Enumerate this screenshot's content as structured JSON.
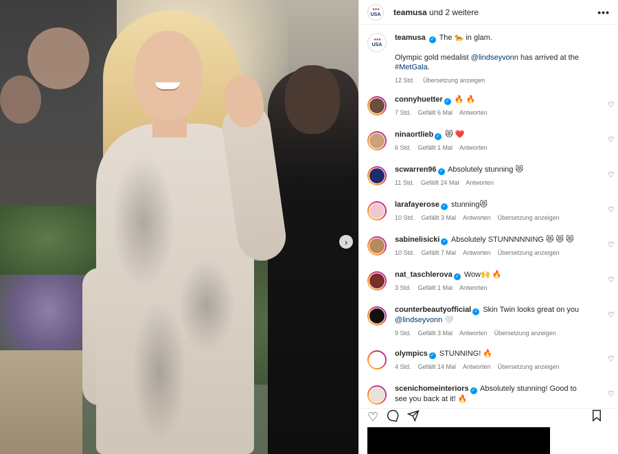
{
  "header": {
    "account": "teamusa",
    "suffix": "und 2 weitere",
    "more_icon": "more-horizontal-icon"
  },
  "logo_text": "USA",
  "caption": {
    "username": "teamusa",
    "line1_a": "The",
    "line1_emoji": "🐆",
    "line1_b": "in glam.",
    "line2_a": "Olympic gold medalist",
    "mention": "@lindseyvonn",
    "line2_b": "has arrived at the",
    "hashtag": "#MetGala",
    "line2_end": ".",
    "time": "12 Std.",
    "translate": "Übersetzung anzeigen"
  },
  "comments": [
    {
      "username": "connyhuetter",
      "text": "🔥 🔥",
      "time": "7 Std.",
      "likes": "Gefällt 6 Mal",
      "reply": "Antworten",
      "translate": "",
      "avatar_color": "#6b4e3d"
    },
    {
      "username": "ninaortlieb",
      "text": "😻 ❤️",
      "time": "6 Std.",
      "likes": "Gefällt 1 Mal",
      "reply": "Antworten",
      "translate": "",
      "avatar_color": "#c9a27a"
    },
    {
      "username": "scwarren96",
      "text": "Absolutely stunning 😻",
      "time": "11 Std.",
      "likes": "Gefällt 24 Mal",
      "reply": "Antworten",
      "translate": "",
      "avatar_color": "#1e2a6b"
    },
    {
      "username": "larafayerose",
      "text": "stunning😻",
      "time": "10 Std.",
      "likes": "Gefällt 3 Mal",
      "reply": "Antworten",
      "translate": "Übersetzung anzeigen",
      "avatar_color": "#f2c7cf"
    },
    {
      "username": "sabinelisicki",
      "text": "Absolutely STUNNNNNING 😻 😻 😻",
      "time": "10 Std.",
      "likes": "Gefällt 7 Mal",
      "reply": "Antworten",
      "translate": "Übersetzung anzeigen",
      "avatar_color": "#b88a5a"
    },
    {
      "username": "nat_taschlerova",
      "text": "Wow🙌 🔥",
      "time": "3 Std.",
      "likes": "Gefällt 1 Mal",
      "reply": "Antworten",
      "translate": "",
      "avatar_color": "#7a2f2a"
    },
    {
      "username": "counterbeautyofficial",
      "text": "Skin Twin looks great on you",
      "mention": "@lindseyvonn",
      "mention_suffix": "🤍",
      "time": "9 Std.",
      "likes": "Gefällt 3 Mal",
      "reply": "Antworten",
      "translate": "Übersetzung anzeigen",
      "avatar_color": "#111111"
    },
    {
      "username": "olympics",
      "text": "STUNNING! 🔥",
      "time": "4 Std.",
      "likes": "Gefällt 14 Mal",
      "reply": "Antworten",
      "translate": "Übersetzung anzeigen",
      "avatar_color": "#ffffff"
    },
    {
      "username": "scenichomeinteriors",
      "text": "Absolutely stunning! Good to see you back at it! 🔥",
      "time": "",
      "likes": "",
      "reply": "",
      "translate": "",
      "avatar_color": "#e8e2da"
    }
  ],
  "actions": {
    "like_icon": "heart-icon",
    "comment_icon": "comment-icon",
    "share_icon": "share-icon",
    "save_icon": "bookmark-icon"
  },
  "photo": {
    "next_icon": "chevron-right-icon"
  }
}
